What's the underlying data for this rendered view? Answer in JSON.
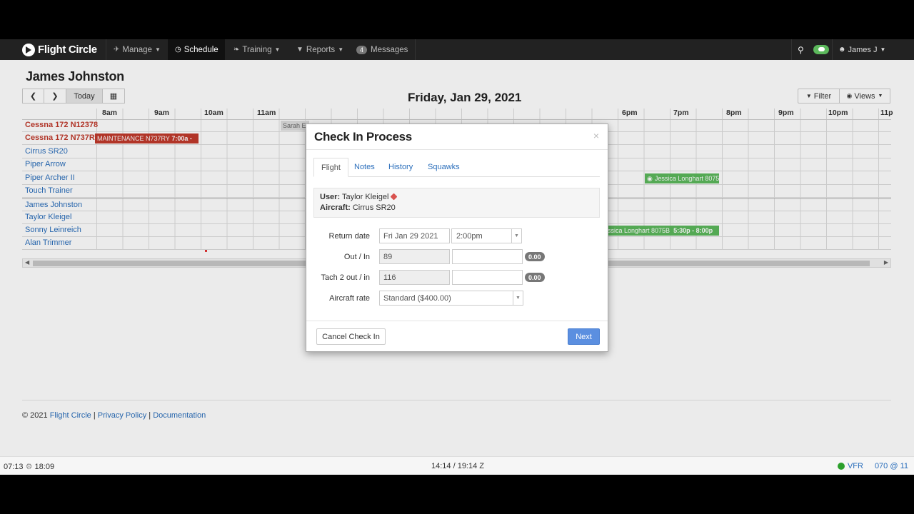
{
  "navbar": {
    "brand": "Flight Circle",
    "items": [
      {
        "label": "Manage",
        "icon": "plane-icon"
      },
      {
        "label": "Schedule",
        "icon": "clock-icon"
      },
      {
        "label": "Training",
        "icon": "leaf-icon"
      },
      {
        "label": "Reports",
        "icon": "filter-icon"
      },
      {
        "label": "Messages",
        "badge": "4"
      }
    ],
    "user": "James J"
  },
  "page": {
    "title": "James Johnston",
    "today_label": "Today",
    "date_heading": "Friday, Jan 29, 2021",
    "filter_label": "Filter",
    "views_label": "Views"
  },
  "schedule": {
    "hours": [
      "8am",
      "9am",
      "10am",
      "11am",
      "6pm",
      "7pm",
      "8pm",
      "9pm",
      "10pm",
      "11p"
    ],
    "resources": [
      {
        "name": "Cessna 172 N12378",
        "style": "red"
      },
      {
        "name": "Cessna 172 N737RY",
        "style": "red"
      },
      {
        "name": "Cirrus SR20",
        "style": "link"
      },
      {
        "name": "Piper Arrow",
        "style": "link"
      },
      {
        "name": "Piper Archer II",
        "style": "link"
      },
      {
        "name": "Touch Trainer",
        "style": "link"
      },
      {
        "name": "James Johnston",
        "style": "link"
      },
      {
        "name": "Taylor Kleigel",
        "style": "link"
      },
      {
        "name": "Sonny Leinreich",
        "style": "link"
      },
      {
        "name": "Alan Trimmer",
        "style": "link"
      }
    ],
    "events": {
      "maintenance": "MAINTENANCE N737RY",
      "maintenance_time": "7:00a -",
      "sarah": "Sarah Eg",
      "jessica_archer": "Jessica Longhart 8075",
      "jessica_sonny": "ssica Longhart 8075B",
      "jessica_sonny_time": "5:30p - 8:00p"
    }
  },
  "footer": {
    "copyright": "© 2021",
    "brand_link": "Flight Circle",
    "sep": "|",
    "privacy": "Privacy Policy",
    "docs": "Documentation"
  },
  "statusbar": {
    "left_time": "07:13",
    "right_time": "18:09",
    "center": "14:14 / 19:14 Z",
    "vfr": "VFR",
    "wind": "070 @ 11"
  },
  "modal": {
    "title": "Check In Process",
    "close": "×",
    "tabs": [
      "Flight",
      "Notes",
      "History",
      "Squawks"
    ],
    "active_tab": "Flight",
    "user_label": "User:",
    "user_value": "Taylor Kleigel",
    "aircraft_label": "Aircraft:",
    "aircraft_value": "Cirrus SR20",
    "return_date_label": "Return date",
    "return_date_value": "Fri Jan 29 2021",
    "return_time_value": "2:00pm",
    "out_in_label": "Out / In",
    "out_value": "89",
    "in_value": "",
    "out_in_diff": "0.00",
    "tach_label": "Tach 2 out / in",
    "tach_out_value": "116",
    "tach_in_value": "",
    "tach_diff": "0.00",
    "rate_label": "Aircraft rate",
    "rate_value": "Standard ($400.00)",
    "cancel_label": "Cancel Check In",
    "next_label": "Next"
  },
  "colors": {
    "navbar_bg": "#222222",
    "link": "#2a6ebb",
    "maintenance": "#c0392b",
    "booking_green": "#5cb85c",
    "primary_button": "#5b8fe0"
  }
}
